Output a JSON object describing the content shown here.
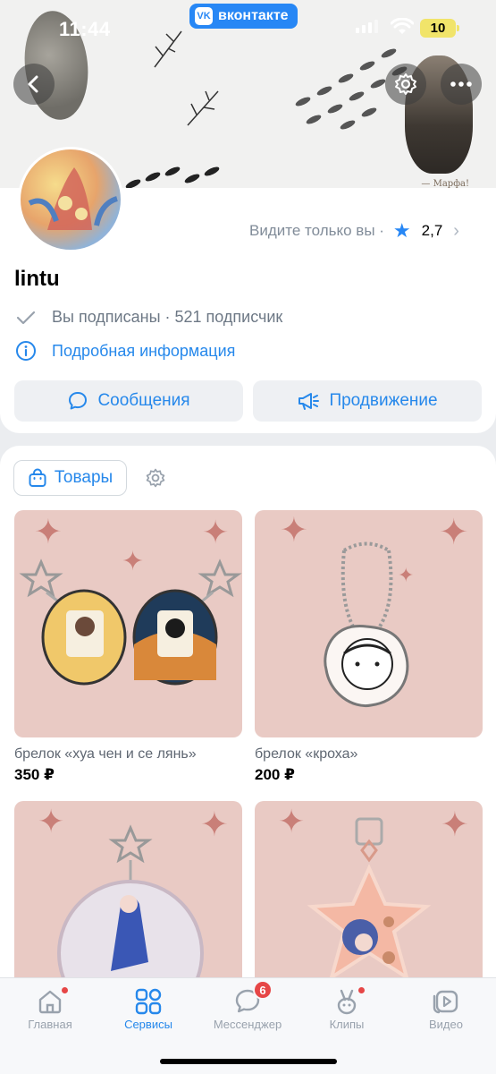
{
  "status_bar": {
    "time": "11:44",
    "app_label": "вконтакте",
    "app_logo": "VK",
    "battery": "10"
  },
  "cover": {
    "caption": "— Марфа!"
  },
  "profile": {
    "name": "lintu",
    "visible_only_you": "Видите только вы ·",
    "rating": "2,7",
    "subscribed": "Вы подписаны · 521 подписчик",
    "more_info": "Подробная информация",
    "messages_button": "Сообщения",
    "promote_button": "Продвижение"
  },
  "goods": {
    "tab_label": "Товары",
    "items": [
      {
        "title": "брелок «хуа чен и се лянь»",
        "price": "350 ₽"
      },
      {
        "title": "брелок «кроха»",
        "price": "200 ₽"
      },
      {
        "title": "",
        "price": ""
      },
      {
        "title": "",
        "price": ""
      }
    ]
  },
  "tabbar": {
    "tabs": [
      {
        "label": "Главная",
        "icon": "home-icon"
      },
      {
        "label": "Сервисы",
        "icon": "services-icon"
      },
      {
        "label": "Мессенджер",
        "icon": "messenger-icon",
        "badge": "6"
      },
      {
        "label": "Клипы",
        "icon": "clips-icon"
      },
      {
        "label": "Видео",
        "icon": "video-icon"
      }
    ],
    "active": "Сервисы"
  },
  "colors": {
    "accent": "#2688eb",
    "vk_blue": "#2787f5",
    "badge_red": "#e64646",
    "product_bg": "#e9cac4"
  }
}
